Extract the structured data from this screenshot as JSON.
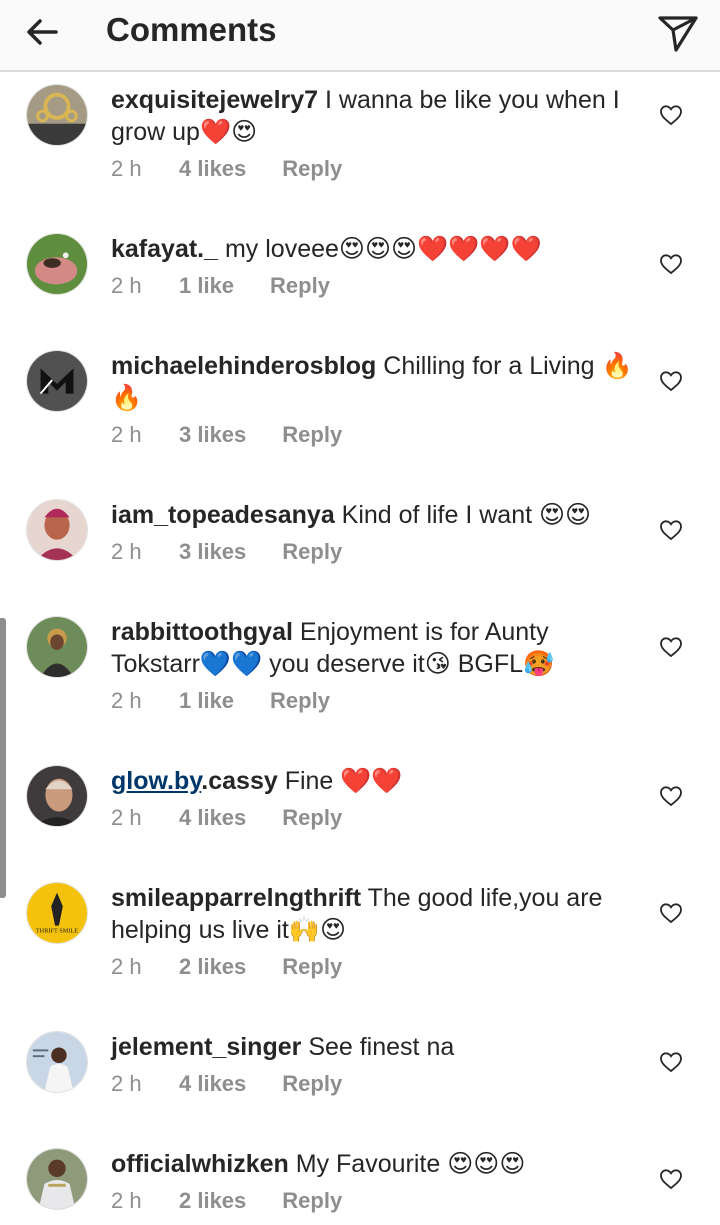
{
  "header": {
    "title": "Comments"
  },
  "comments": [
    {
      "username": "exquisitejewelry7",
      "text": "I wanna be like you when I grow up❤️😍",
      "time": "2 h",
      "likes": "4 likes",
      "reply": "Reply"
    },
    {
      "username": "kafayat._",
      "text": "my loveee😍😍😍❤️❤️❤️❤️",
      "time": "2 h",
      "likes": "1 like",
      "reply": "Reply"
    },
    {
      "username": "michaelehinderosblog",
      "text": "Chilling for a Living 🔥🔥",
      "time": "2 h",
      "likes": "3 likes",
      "reply": "Reply"
    },
    {
      "username": "iam_topeadesanya",
      "text": "Kind of life I want 😍😍",
      "time": "2 h",
      "likes": "3 likes",
      "reply": "Reply"
    },
    {
      "username": "rabbittoothgyal",
      "text": "Enjoyment is for Aunty Tokstarr💙💙 you deserve it😘 BGFL🥵",
      "time": "2 h",
      "likes": "1 like",
      "reply": "Reply"
    },
    {
      "username_part1": "glow.by",
      "username_part2": ".cassy",
      "text": "Fine ❤️❤️",
      "time": "2 h",
      "likes": "4 likes",
      "reply": "Reply"
    },
    {
      "username": "smileapparrelngthrift",
      "text": "The good life,you are helping us live it🙌😍",
      "time": "2 h",
      "likes": "2 likes",
      "reply": "Reply",
      "avatar_text": "THRIFT SMILE"
    },
    {
      "username": "jelement_singer",
      "text": "See finest na",
      "time": "2 h",
      "likes": "4 likes",
      "reply": "Reply"
    },
    {
      "username": "officialwhizken",
      "text": "My Favourite 😍😍😍",
      "time": "2 h",
      "likes": "2 likes",
      "reply": "Reply"
    }
  ]
}
